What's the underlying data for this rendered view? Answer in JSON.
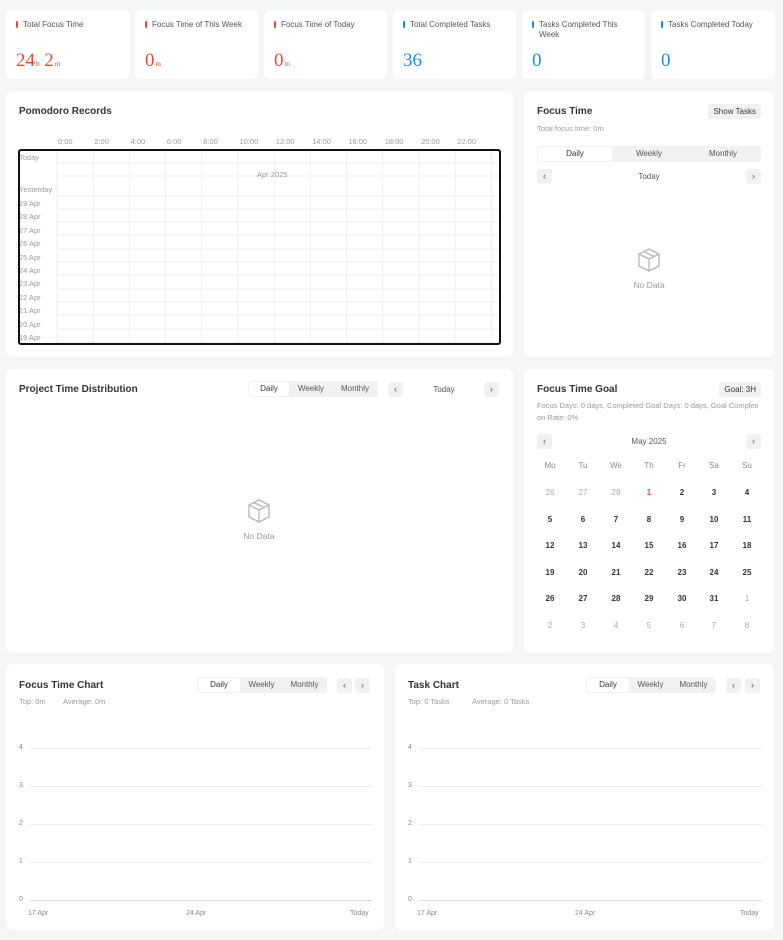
{
  "stats": [
    {
      "label": "Total Focus Time",
      "value_a": "24",
      "unit_a": "h",
      "value_b": "2",
      "unit_b": "m",
      "color": "#e84a3a"
    },
    {
      "label": "Focus Time of This Week",
      "value_a": "0",
      "unit_a": "m",
      "color": "#e84a3a"
    },
    {
      "label": "Focus Time of Today",
      "value_a": "0",
      "unit_a": "m",
      "color": "#e84a3a"
    },
    {
      "label": "Total Completed Tasks",
      "value_a": "36",
      "color": "#1a8ed8"
    },
    {
      "label": "Tasks Completed This Week",
      "value_a": "0",
      "color": "#1a8ed8"
    },
    {
      "label": "Tasks Completed Today",
      "value_a": "0",
      "color": "#1a8ed8"
    }
  ],
  "records": {
    "title": "Pomodoro Records",
    "hours": [
      "0:00",
      "2:00",
      "4:00",
      "6:00",
      "8:00",
      "10:00",
      "12:00",
      "14:00",
      "16:00",
      "18:00",
      "20:00",
      "22:00"
    ],
    "month_label": "Apr 2025",
    "rows": [
      "Today",
      "Yesterday",
      "29 Apr",
      "28 Apr",
      "27 Apr",
      "26 Apr",
      "25 Apr",
      "24 Apr",
      "23 Apr",
      "22 Apr",
      "21 Apr",
      "20 Apr",
      "19 Apr"
    ]
  },
  "focus_time": {
    "title": "Focus Time",
    "show_tasks": "Show Tasks",
    "total": "Total focus time: 0m",
    "tabs": [
      "Daily",
      "Weekly",
      "Monthly"
    ],
    "period": "Today",
    "no_data": "No Data"
  },
  "project": {
    "title": "Project Time Distribution",
    "tabs": [
      "Daily",
      "Weekly",
      "Monthly"
    ],
    "period": "Today",
    "no_data": "No Data"
  },
  "goal": {
    "title": "Focus Time Goal",
    "goal_badge": "Goal: 3H",
    "summary": "Focus Days: 0 days,  Completed Goal Days: 0 days,  Goal Completion Rate: 0%",
    "month": "May 2025",
    "weekdays": [
      "Mo",
      "Tu",
      "We",
      "Th",
      "Fr",
      "Sa",
      "Su"
    ],
    "weeks": [
      [
        "26",
        "27",
        "28",
        "1",
        "2",
        "3",
        "4"
      ],
      [
        "5",
        "6",
        "7",
        "8",
        "9",
        "10",
        "11"
      ],
      [
        "12",
        "13",
        "14",
        "15",
        "16",
        "17",
        "18"
      ],
      [
        "19",
        "20",
        "21",
        "22",
        "23",
        "24",
        "25"
      ],
      [
        "26",
        "27",
        "28",
        "29",
        "30",
        "31",
        "1"
      ],
      [
        "2",
        "3",
        "4",
        "5",
        "6",
        "7",
        "8"
      ]
    ]
  },
  "focus_chart": {
    "title": "Focus Time Chart",
    "tabs": [
      "Daily",
      "Weekly",
      "Monthly"
    ],
    "top": "Top: 0m",
    "average": "Average: 0m",
    "y_ticks": [
      "4",
      "3",
      "2",
      "1",
      "0"
    ],
    "x_ticks": [
      "17 Apr",
      "24 Apr",
      "Today"
    ]
  },
  "task_chart": {
    "title": "Task Chart",
    "tabs": [
      "Daily",
      "Weekly",
      "Monthly"
    ],
    "top": "Top:  0 Tasks",
    "average": "Average:  0 Tasks",
    "y_ticks": [
      "4",
      "3",
      "2",
      "1",
      "0"
    ],
    "x_ticks": [
      "17 Apr",
      "24 Apr",
      "Today"
    ]
  },
  "chart_data": [
    {
      "type": "bar",
      "title": "Focus Time Chart",
      "categories": [
        "17 Apr",
        "24 Apr",
        "Today"
      ],
      "values": [],
      "ylim": [
        0,
        4
      ],
      "grid": true
    },
    {
      "type": "bar",
      "title": "Task Chart",
      "categories": [
        "17 Apr",
        "24 Apr",
        "Today"
      ],
      "values": [],
      "ylim": [
        0,
        4
      ],
      "grid": true
    }
  ]
}
